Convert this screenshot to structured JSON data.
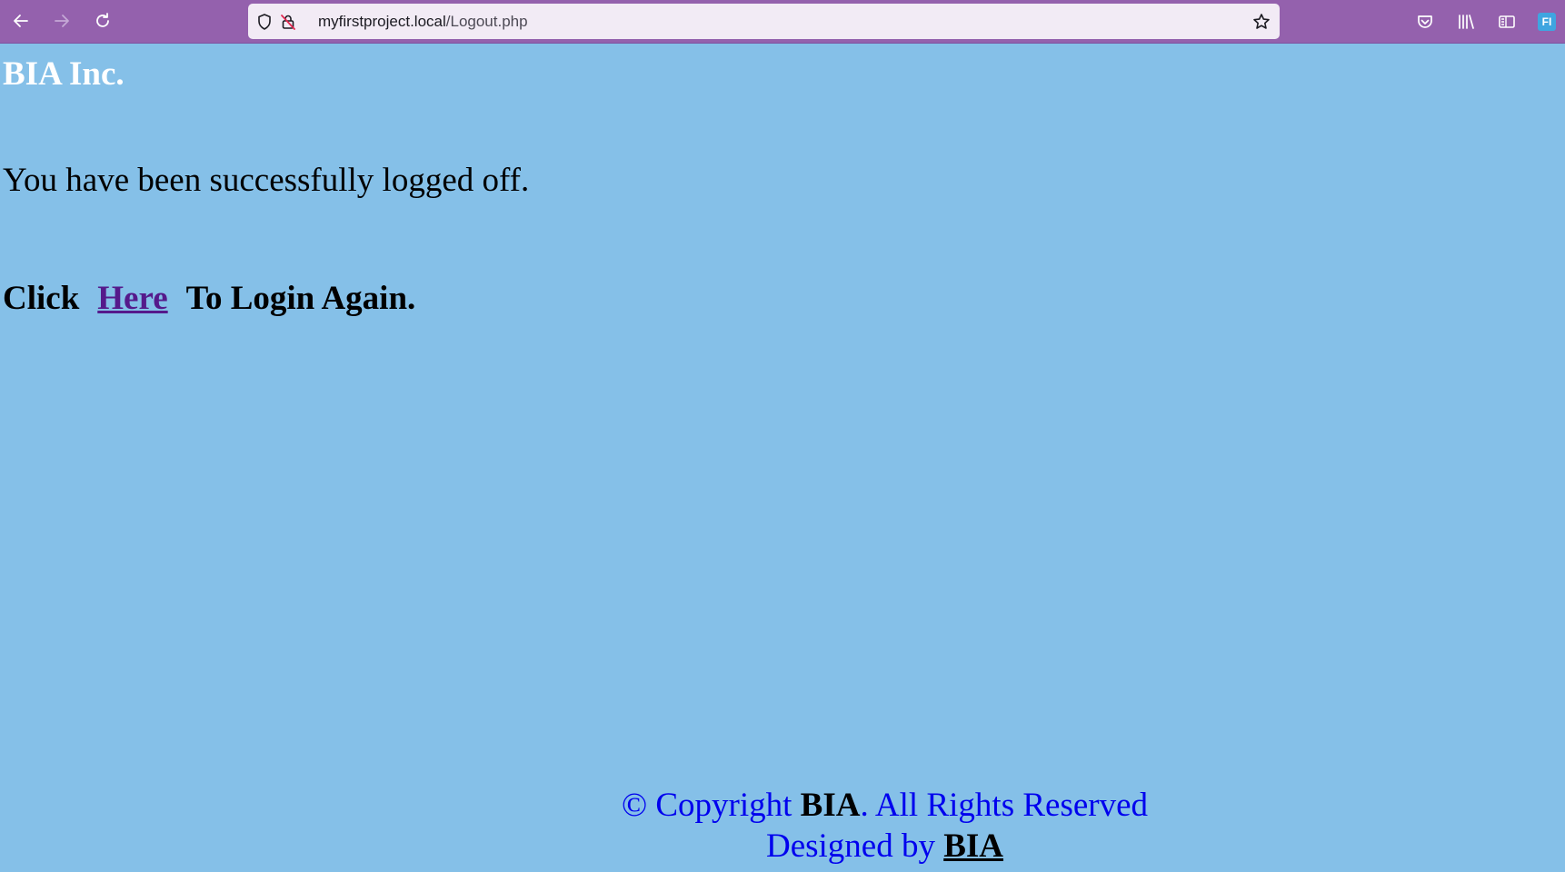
{
  "browser": {
    "url_host": "myfirstproject.local",
    "url_path": "/Logout.php",
    "profile_initials": "FI",
    "colors": {
      "toolbar": "#9461ad",
      "urlbar": "#f2ebf5"
    },
    "icons": {
      "back": "arrow-left",
      "forward": "arrow-right",
      "reload": "circular-arrow",
      "tracking_protection": "shield",
      "insecure": "crossed-lock",
      "bookmark": "star-outline",
      "pocket": "pocket",
      "library": "books",
      "sidebar": "sidebar",
      "profile": "account-badge"
    }
  },
  "page": {
    "background": "#85c0e8",
    "brand": "BIA Inc.",
    "message": "You have been successfully logged off.",
    "relogin": {
      "prefix": "Click",
      "link_label": "Here",
      "suffix": "To Login Again."
    },
    "footer": {
      "copyright_prefix": "© Copyright",
      "copyright_brand": "BIA",
      "copyright_suffix": ". All Rights Reserved",
      "designed_prefix": "Designed by",
      "designed_brand": "BIA"
    }
  }
}
